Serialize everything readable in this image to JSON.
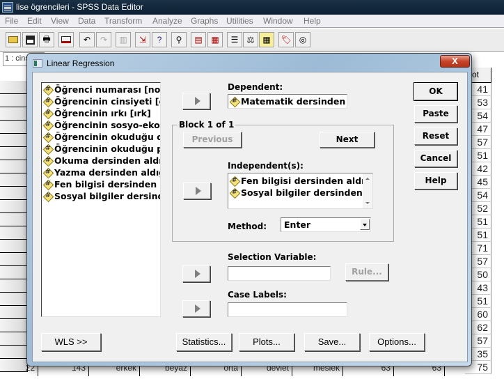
{
  "app": {
    "title": "lise ögrencileri - SPSS Data Editor",
    "menu": [
      "File",
      "Edit",
      "View",
      "Data",
      "Transform",
      "Analyze",
      "Graphs",
      "Utilities",
      "Window",
      "Help"
    ],
    "toolbar_icons": [
      "open-icon",
      "save-icon",
      "print-icon",
      "dialog-recall-icon",
      "undo-icon",
      "redo-icon",
      "chart-icon",
      "goto-case-icon",
      "variables-icon",
      "find-icon",
      "insert-cases-icon",
      "insert-variable-icon",
      "split-file-icon",
      "weight-cases-icon",
      "select-cases-icon",
      "value-labels-icon",
      "use-sets-icon"
    ],
    "cell_ref": "1 : cins"
  },
  "grid": {
    "right_column_header": "ot",
    "right_column_values": [
      "41",
      "53",
      "54",
      "47",
      "57",
      "51",
      "42",
      "45",
      "54",
      "52",
      "51",
      "51",
      "71",
      "57",
      "50",
      "43",
      "51",
      "60",
      "62",
      "57",
      "35",
      "75"
    ],
    "bottom_row": [
      "22",
      "143",
      "erkek",
      "beyaz",
      "orta",
      "devlet",
      "meslek",
      "63",
      "63"
    ]
  },
  "dialog": {
    "title": "Linear Regression",
    "close_label": "X",
    "source_variables": [
      "Öğrenci numarası [no]",
      "Öğrencinin cinsiyeti [cins]",
      "Öğrencinin ırkı [ırk]",
      "Öğrencinin sosyo-ekonomik",
      "Öğrencinin okuduğu okul",
      "Öğrencinin okuduğu program",
      "Okuma dersinden aldığı",
      "Yazma dersinden aldığı",
      "Fen bilgisi dersinden aldığı",
      "Sosyal bilgiler dersinden"
    ],
    "dependent_label": "Dependent:",
    "dependent_value": "Matematik dersinden aldığı",
    "block_label": "Block 1 of 1",
    "previous_label": "Previous",
    "next_label": "Next",
    "independents_label": "Independent(s):",
    "independents": [
      "Fen bilgisi dersinden aldığı",
      "Sosyal bilgiler dersinden aldığı"
    ],
    "method_label": "Method:",
    "method_value": "Enter",
    "selection_variable_label": "Selection Variable:",
    "selection_variable_value": "",
    "rule_label": "Rule...",
    "case_labels_label": "Case Labels:",
    "case_labels_value": "",
    "buttons": {
      "ok": "OK",
      "paste": "Paste",
      "reset": "Reset",
      "cancel": "Cancel",
      "help": "Help",
      "wls": "WLS >>",
      "statistics": "Statistics...",
      "plots": "Plots...",
      "save": "Save...",
      "options": "Options..."
    }
  }
}
